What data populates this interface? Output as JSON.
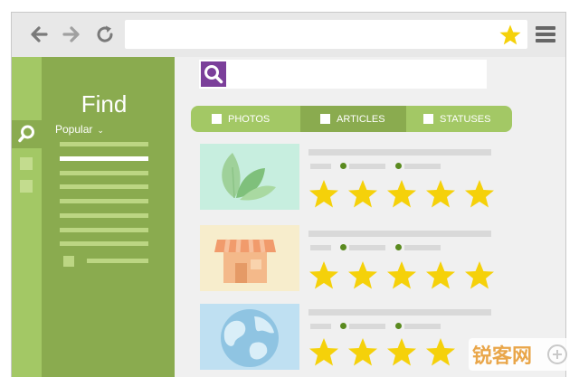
{
  "browser": {
    "back_icon": "arrow-left-icon",
    "forward_icon": "arrow-right-icon",
    "reload_icon": "reload-icon",
    "url_value": "",
    "bookmark_icon": "star-icon",
    "menu_icon": "hamburger-menu-icon"
  },
  "sidebar": {
    "title": "Find",
    "filter_label": "Popular",
    "filter_icon": "chevron-down-icon",
    "rail_icons": [
      "search-icon",
      "square-icon",
      "square-icon"
    ]
  },
  "search": {
    "value": "",
    "icon": "search-icon"
  },
  "tabs": [
    {
      "label": "PHOTOS",
      "active": false
    },
    {
      "label": "ARTICLES",
      "active": true
    },
    {
      "label": "STATUSES",
      "active": false
    }
  ],
  "results": [
    {
      "thumbnail": "leaves-image",
      "rating": 5
    },
    {
      "thumbnail": "shop-image",
      "rating": 5
    },
    {
      "thumbnail": "globe-image",
      "rating": 5
    }
  ],
  "watermark": {
    "text": "锐客网",
    "icon": "logo-icon"
  },
  "colors": {
    "green_light": "#a3c865",
    "green_dark": "#8aab4f",
    "purple": "#7b3f9a",
    "star": "#f5d10a"
  }
}
